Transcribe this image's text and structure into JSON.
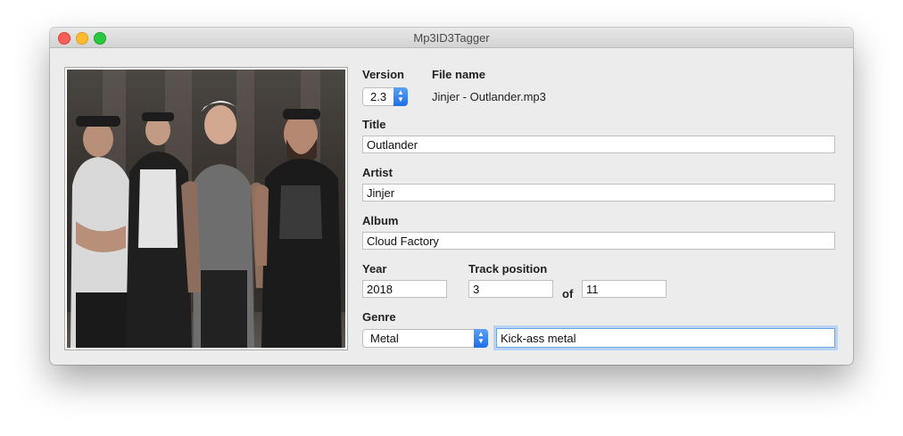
{
  "window": {
    "title": "Mp3ID3Tagger"
  },
  "version": {
    "label": "Version",
    "value": "2.3"
  },
  "file_name": {
    "label": "File name",
    "value": "Jinjer - Outlander.mp3"
  },
  "title_field": {
    "label": "Title",
    "value": "Outlander"
  },
  "artist": {
    "label": "Artist",
    "value": "Jinjer"
  },
  "album": {
    "label": "Album",
    "value": "Cloud Factory"
  },
  "year": {
    "label": "Year",
    "value": "2018"
  },
  "track": {
    "label": "Track position",
    "value": "3",
    "of_label": "of",
    "total": "11"
  },
  "genre": {
    "label": "Genre",
    "selected": "Metal",
    "custom": "Kick-ass metal"
  },
  "icons": {
    "cover": "album-cover-image",
    "stepper": "up-down-arrows-icon"
  }
}
